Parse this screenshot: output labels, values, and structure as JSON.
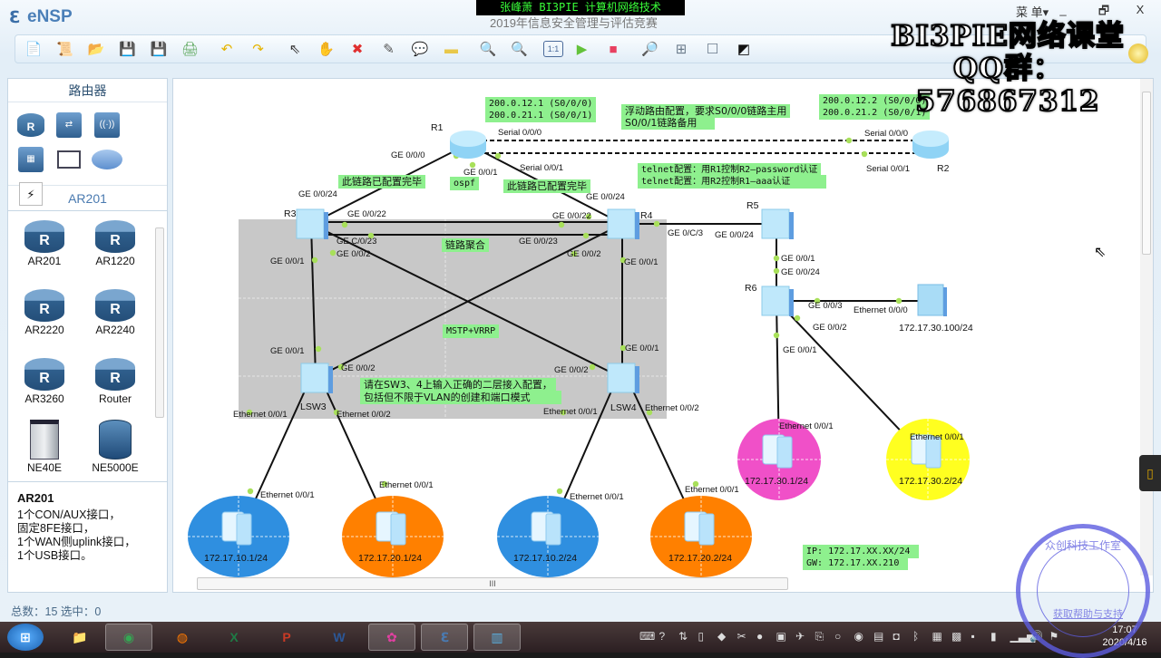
{
  "app": {
    "name": "eNSP",
    "topic_title": "2019年信息安全管理与评估竞赛",
    "menu_label": "菜 单▾",
    "window_controls": {
      "minimize": "_",
      "restore": "🗗",
      "close": "X"
    }
  },
  "overlay": {
    "caption": "张峰萧 BI3PIE 计算机网络技术",
    "watermark_line1": "BI3PIE网络课堂",
    "watermark_line2": "QQ群：576867312"
  },
  "toolbar": {
    "buttons": [
      {
        "name": "new-topology-icon",
        "glyph": "📄",
        "color": "#6aa84f"
      },
      {
        "name": "new-example-icon",
        "glyph": "📜",
        "color": "#6aa84f"
      },
      {
        "name": "open-icon",
        "glyph": "📂",
        "color": "#e9b64b"
      },
      {
        "name": "save-icon",
        "glyph": "💾",
        "color": "#4a7ab0"
      },
      {
        "name": "save-as-icon",
        "glyph": "💾",
        "color": "#4a7ab0"
      },
      {
        "name": "print-icon",
        "glyph": "🖨",
        "color": "#5aa65a"
      },
      {
        "name": "undo-icon",
        "glyph": "↶",
        "color": "#e5b400"
      },
      {
        "name": "redo-icon",
        "glyph": "↷",
        "color": "#e5b400"
      },
      {
        "name": "select-icon",
        "glyph": "⇖",
        "color": "#333333"
      },
      {
        "name": "pan-hand-icon",
        "glyph": "✋",
        "color": "#e0a050"
      },
      {
        "name": "delete-icon",
        "glyph": "✖",
        "color": "#e03030"
      },
      {
        "name": "delete-link-icon",
        "glyph": "✎",
        "color": "#555555"
      },
      {
        "name": "text-note-icon",
        "glyph": "💬",
        "color": "#6a8fb8"
      },
      {
        "name": "rectangle-icon",
        "glyph": "▬",
        "color": "#e8c84a"
      },
      {
        "name": "zoom-in-icon",
        "glyph": "🔍",
        "color": "#4caf50"
      },
      {
        "name": "zoom-out-icon",
        "glyph": "🔍",
        "color": "#4a7ab0"
      },
      {
        "name": "fit-1to1-icon",
        "glyph": "1:1",
        "color": "#4a6a9a"
      },
      {
        "name": "start-device-icon",
        "glyph": "▶",
        "color": "#63c23a"
      },
      {
        "name": "stop-device-icon",
        "glyph": "■",
        "color": "#e84060"
      },
      {
        "name": "capture-icon",
        "glyph": "🔎",
        "color": "#7a8a9a"
      },
      {
        "name": "topology-tree-icon",
        "glyph": "⊞",
        "color": "#6a7a8a"
      },
      {
        "name": "window-icon",
        "glyph": "☐",
        "color": "#6a7a8a"
      },
      {
        "name": "console-icon",
        "glyph": "◩",
        "color": "#111111"
      }
    ]
  },
  "left_panel": {
    "category_title": "路由器",
    "category_icons": [
      {
        "name": "router-category-icon",
        "glyph": "R"
      },
      {
        "name": "switch-category-icon",
        "glyph": "⇄"
      },
      {
        "name": "wlan-category-icon",
        "glyph": "((·))"
      },
      {
        "name": "firewall-category-icon",
        "glyph": "▦"
      },
      {
        "name": "terminal-category-icon",
        "glyph": "🖥"
      },
      {
        "name": "cloud-category-icon",
        "glyph": "☁"
      },
      {
        "name": "connection-category-icon",
        "glyph": "⚡"
      }
    ],
    "sub_title": "AR201",
    "devices": [
      {
        "label": "AR201",
        "type": "router"
      },
      {
        "label": "AR1220",
        "type": "router"
      },
      {
        "label": "AR2220",
        "type": "router"
      },
      {
        "label": "AR2240",
        "type": "router"
      },
      {
        "label": "AR3260",
        "type": "router"
      },
      {
        "label": "Router",
        "type": "router"
      },
      {
        "label": "NE40E",
        "type": "chassis"
      },
      {
        "label": "NE5000E",
        "type": "cylinder"
      }
    ],
    "description": {
      "title": "AR201",
      "lines": [
        "1个CON/AUX接口，",
        "固定8FE接口，",
        "1个WAN侧uplink接口，",
        "1个USB接口。"
      ]
    }
  },
  "status_bar": {
    "text": "总数：15  选中：0"
  },
  "topology": {
    "devices": {
      "R1": {
        "label": "R1"
      },
      "R2": {
        "label": "R2"
      },
      "R3": {
        "label": "R3"
      },
      "R4": {
        "label": "R4"
      },
      "R5": {
        "label": "R5"
      },
      "R6": {
        "label": "R6"
      },
      "LSW3": {
        "label": "LSW3"
      },
      "LSW4": {
        "label": "LSW4"
      },
      "server": {
        "label": "172.17.30.100/24"
      },
      "pc1": {
        "label": "172.17.10.1/24",
        "color": "#2f8fe0"
      },
      "pc2": {
        "label": "172.17.20.1/24",
        "color": "#ff8000"
      },
      "pc3": {
        "label": "172.17.10.2/24",
        "color": "#2f8fe0"
      },
      "pc4": {
        "label": "172.17.20.2/24",
        "color": "#ff8000"
      },
      "pc5": {
        "label": "172.17.30.1/24",
        "color": "#f050c8"
      },
      "pc6": {
        "label": "172.17.30.2/24",
        "color": "#ffff20"
      }
    },
    "port_labels": [
      "Serial 0/0/0",
      "Serial 0/0/1",
      "GE 0/0/0",
      "GE 0/0/1",
      "Serial 0/0/0",
      "Serial 0/0/1",
      "GE 0/0/24",
      "GE 0/0/24",
      "GE 0/0/22",
      "GE 0/0/22",
      "GE C/0/23",
      "GE 0/0/23",
      "GE 0/0/1",
      "GE 0/0/2",
      "GE 0/0/2",
      "GE 0/0/1",
      "GE 0/C/3",
      "GE 0/0/24",
      "GE 0/0/1",
      "GE 0/0/24",
      "GE 0/0/3",
      "Ethernet 0/0/0",
      "GE 0/0/2",
      "GE 0/0/1",
      "GE 0/0/1",
      "GE 0/0/2",
      "GE 0/0/2",
      "GE 0/0/1",
      "Ethernet 0/0/1",
      "Ethernet 0/0/2",
      "Ethernet 0/0/1",
      "Ethernet 0/0/2",
      "Ethernet 0/0/1",
      "Ethernet 0/0/1",
      "Ethernet 0/0/1",
      "Ethernet 0/0/1",
      "Ethernet 0/0/1",
      "Ethernet 0/0/1"
    ],
    "notes": {
      "r1_ips": [
        "200.0.12.1 (S0/0/0)",
        "200.0.21.1 (S0/0/1)"
      ],
      "r2_ips": [
        "200.0.12.2 (S0/0/0)",
        "200.0.21.2 (S0/0/1)"
      ],
      "floating_route": [
        "浮动路由配置，要求S0/0/0链路主用",
        "S0/0/1链路备用"
      ],
      "telnet": [
        "telnet配置：用R1控制R2—password认证",
        "telnet配置：用R2控制R1—aaa认证"
      ],
      "link_done_left": "此链路已配置完毕",
      "link_done_right": "此链路已配置完毕",
      "ospf": "ospf",
      "link_agg": "链路聚合",
      "mstp_vrrp": "MSTP+VRRP",
      "sw_config": [
        "请在SW3、4上输入正确的二层接入配置，",
        "包括但不限于VLAN的创建和端口模式"
      ],
      "ip_gw": [
        "IP: 172.17.XX.XX/24",
        "GW: 172.17.XX.210"
      ]
    }
  },
  "canvas_scrollbar": {
    "grip": "III"
  },
  "stamp": {
    "text": "众创科技工作室",
    "link": "获取帮助与支持"
  },
  "taskbar": {
    "apps": [
      {
        "name": "start-button",
        "glyph": "⊞",
        "color": "#3a8ee6"
      },
      {
        "name": "explorer-icon",
        "glyph": "📁",
        "color": "#f0c040"
      },
      {
        "name": "chrome-icon",
        "glyph": "◉",
        "color": "#34a853"
      },
      {
        "name": "firefox-icon",
        "glyph": "◍",
        "color": "#ff7a00"
      },
      {
        "name": "excel-icon",
        "glyph": "X",
        "color": "#1e7b45"
      },
      {
        "name": "powerpoint-icon",
        "glyph": "P",
        "color": "#c83a25"
      },
      {
        "name": "word-icon",
        "glyph": "W",
        "color": "#2b5797"
      },
      {
        "name": "colorful-app-icon",
        "glyph": "✿",
        "color": "#e040a0"
      },
      {
        "name": "ensp-app-icon",
        "glyph": "ℇ",
        "color": "#4a7ab0"
      },
      {
        "name": "archive-app-icon",
        "glyph": "▥",
        "color": "#5ab0e0"
      }
    ],
    "clock_time": "17:07",
    "clock_date": "2020/4/16"
  }
}
